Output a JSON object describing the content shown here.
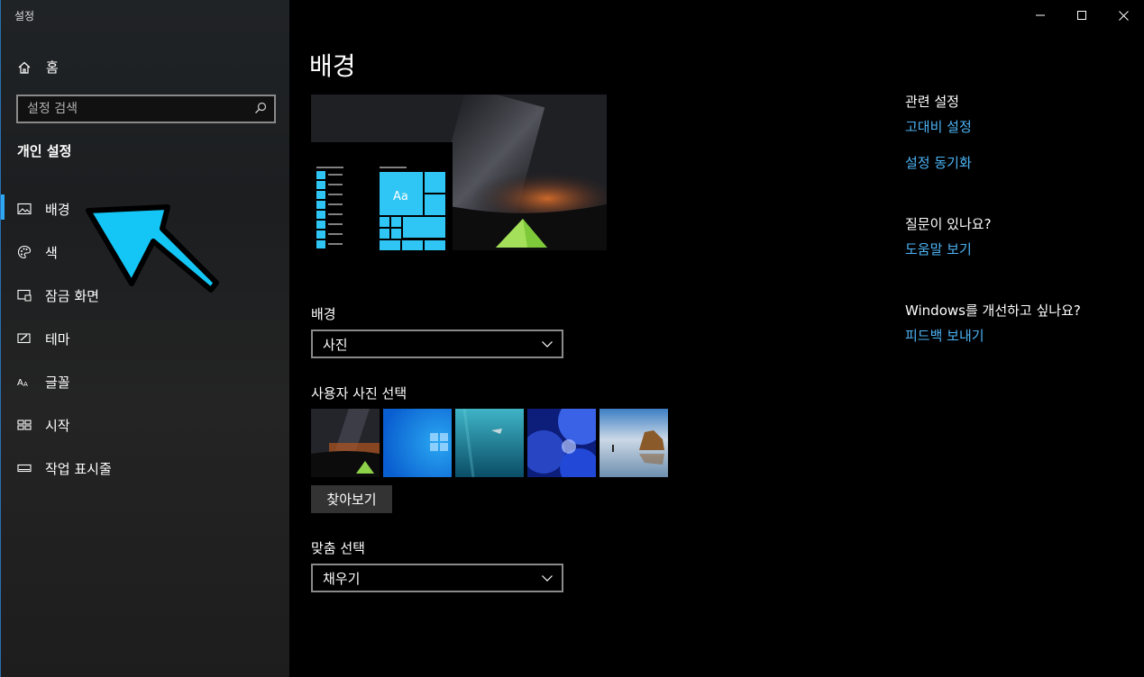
{
  "window": {
    "title": "설정"
  },
  "sidebar": {
    "home_label": "홈",
    "search_placeholder": "설정 검색",
    "section_title": "개인 설정",
    "items": [
      {
        "label": "배경",
        "icon": "picture-icon",
        "active": true
      },
      {
        "label": "색",
        "icon": "palette-icon",
        "active": false
      },
      {
        "label": "잠금 화면",
        "icon": "lock-screen-icon",
        "active": false
      },
      {
        "label": "테마",
        "icon": "theme-icon",
        "active": false
      },
      {
        "label": "글꼴",
        "icon": "font-icon",
        "active": false
      },
      {
        "label": "시작",
        "icon": "start-icon",
        "active": false
      },
      {
        "label": "작업 표시줄",
        "icon": "taskbar-icon",
        "active": false
      }
    ]
  },
  "main": {
    "title": "배경",
    "preview": {
      "tile_text": "Aa"
    },
    "background_label": "배경",
    "background_value": "사진",
    "choose_picture_label": "사용자 사진 선택",
    "browse_label": "찾아보기",
    "fit_label": "맞춤 선택",
    "fit_value": "채우기"
  },
  "related": {
    "heading": "관련 설정",
    "links": [
      "고대비 설정",
      "설정 동기화"
    ],
    "question_heading": "질문이 있나요?",
    "help_link": "도움말 보기",
    "improve_heading": "Windows를 개선하고 싶나요?",
    "feedback_link": "피드백 보내기"
  },
  "colors": {
    "accent": "#2ea8f5",
    "link": "#4cb3f5",
    "arrow": "#14c6f5"
  }
}
